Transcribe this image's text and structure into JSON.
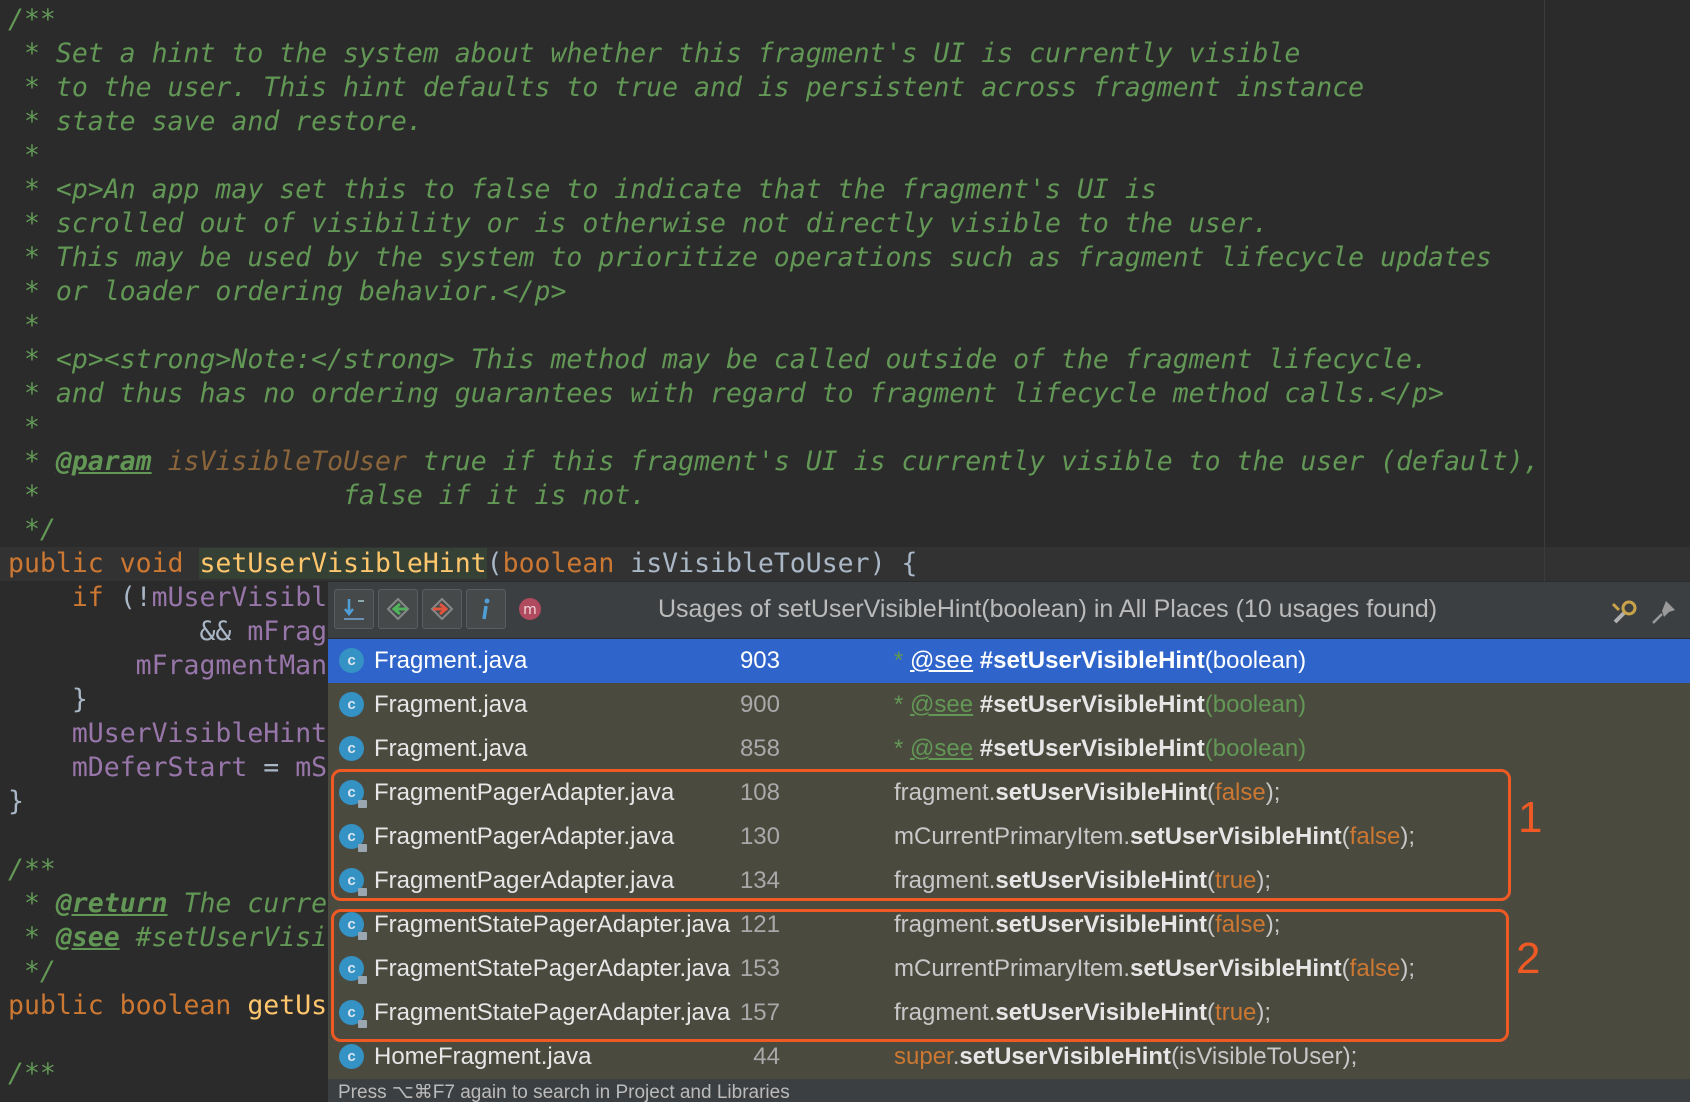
{
  "editor": {
    "lines": [
      {
        "segs": [
          {
            "t": "/**",
            "c": "doc"
          }
        ]
      },
      {
        "segs": [
          {
            "t": " * Set a hint to the system about whether this fragment's UI is currently visible",
            "c": "doc"
          }
        ]
      },
      {
        "segs": [
          {
            "t": " * to the user. This hint defaults to true and is persistent across fragment instance",
            "c": "doc"
          }
        ]
      },
      {
        "segs": [
          {
            "t": " * state save and restore.",
            "c": "doc"
          }
        ]
      },
      {
        "segs": [
          {
            "t": " *",
            "c": "doc"
          }
        ]
      },
      {
        "segs": [
          {
            "t": " * ",
            "c": "doc"
          },
          {
            "t": "<p>",
            "c": "tag"
          },
          {
            "t": "An app may set this to false to indicate that the fragment's UI is",
            "c": "doc"
          }
        ]
      },
      {
        "segs": [
          {
            "t": " * scrolled out of visibility or is otherwise not directly visible to the user.",
            "c": "doc"
          }
        ]
      },
      {
        "segs": [
          {
            "t": " * This may be used by the system to prioritize operations such as fragment lifecycle updates",
            "c": "doc"
          }
        ]
      },
      {
        "segs": [
          {
            "t": " * or loader ordering behavior.",
            "c": "doc"
          },
          {
            "t": "</p>",
            "c": "tag"
          }
        ]
      },
      {
        "segs": [
          {
            "t": " *",
            "c": "doc"
          }
        ]
      },
      {
        "segs": [
          {
            "t": " * ",
            "c": "doc"
          },
          {
            "t": "<p><strong>",
            "c": "tag"
          },
          {
            "t": "Note:",
            "c": "doc"
          },
          {
            "t": "</strong>",
            "c": "tag"
          },
          {
            "t": " This method may be called outside of the fragment lifecycle.",
            "c": "doc"
          }
        ]
      },
      {
        "segs": [
          {
            "t": " * and thus has no ordering guarantees with regard to fragment lifecycle method calls.",
            "c": "doc"
          },
          {
            "t": "</p>",
            "c": "tag"
          }
        ]
      },
      {
        "segs": [
          {
            "t": " *",
            "c": "doc"
          }
        ]
      },
      {
        "segs": [
          {
            "t": " * ",
            "c": "doc"
          },
          {
            "t": "@param",
            "c": "dtag"
          },
          {
            "t": " ",
            "c": "doc"
          },
          {
            "t": "isVisibleToUser",
            "c": "dparam"
          },
          {
            "t": " true if this fragment's UI is currently visible to the user (default),",
            "c": "doc"
          }
        ]
      },
      {
        "segs": [
          {
            "t": " *                   false if it is not.",
            "c": "doc"
          }
        ]
      },
      {
        "segs": [
          {
            "t": " */",
            "c": "doc"
          }
        ]
      },
      {
        "segs": [
          {
            "t": "public void ",
            "c": "kw"
          },
          {
            "t": "setUserVisibleHint",
            "c": "fn decl-hl"
          },
          {
            "t": "(",
            "c": ""
          },
          {
            "t": "boolean ",
            "c": "kw"
          },
          {
            "t": "isVisibleToUser) {",
            "c": ""
          }
        ]
      },
      {
        "segs": [
          {
            "t": "    ",
            "c": ""
          },
          {
            "t": "if ",
            "c": "kw"
          },
          {
            "t": "(!",
            "c": ""
          },
          {
            "t": "mUserVisibl",
            "c": "fld"
          }
        ]
      },
      {
        "segs": [
          {
            "t": "            && ",
            "c": ""
          },
          {
            "t": "mFrag",
            "c": "fld"
          }
        ]
      },
      {
        "segs": [
          {
            "t": "        ",
            "c": ""
          },
          {
            "t": "mFragmentMan",
            "c": "fld"
          }
        ]
      },
      {
        "segs": [
          {
            "t": "    }",
            "c": ""
          }
        ]
      },
      {
        "segs": [
          {
            "t": "    ",
            "c": ""
          },
          {
            "t": "mUserVisibleHint",
            "c": "fld"
          }
        ]
      },
      {
        "segs": [
          {
            "t": "    ",
            "c": ""
          },
          {
            "t": "mDeferStart",
            "c": "fld"
          },
          {
            "t": " = ",
            "c": ""
          },
          {
            "t": "mS",
            "c": "fld"
          }
        ]
      },
      {
        "segs": [
          {
            "t": "}",
            "c": ""
          }
        ]
      },
      {
        "segs": [
          {
            "t": "",
            "c": ""
          }
        ]
      },
      {
        "segs": [
          {
            "t": "/**",
            "c": "doc"
          }
        ]
      },
      {
        "segs": [
          {
            "t": " * ",
            "c": "doc"
          },
          {
            "t": "@return",
            "c": "dtag"
          },
          {
            "t": " The curre",
            "c": "doc"
          }
        ]
      },
      {
        "segs": [
          {
            "t": " * ",
            "c": "doc"
          },
          {
            "t": "@see",
            "c": "dtag"
          },
          {
            "t": " #setUserVisi",
            "c": "doc"
          }
        ]
      },
      {
        "segs": [
          {
            "t": " */",
            "c": "doc"
          }
        ]
      },
      {
        "segs": [
          {
            "t": "public boolean ",
            "c": "kw"
          },
          {
            "t": "getUs",
            "c": "fn"
          }
        ]
      },
      {
        "segs": [
          {
            "t": "",
            "c": ""
          }
        ]
      },
      {
        "segs": [
          {
            "t": "/**",
            "c": "doc"
          }
        ]
      }
    ]
  },
  "popup": {
    "title": "Usages of setUserVisibleHint(boolean) in All Places (10 usages found)",
    "icons": [
      "expand-icon",
      "previous-occurrence-icon",
      "next-occurrence-icon",
      "info-icon",
      "method-icon"
    ],
    "rows": [
      {
        "file": "Fragment.java",
        "line": "903",
        "locked": false,
        "selected": true,
        "code": [
          {
            "t": "* ",
            "c": "dc"
          },
          {
            "t": "@see",
            "c": "dcu"
          },
          {
            "t": " ",
            "c": "dc"
          },
          {
            "t": "#setUserVisibleHint",
            "c": "m"
          },
          {
            "t": "(boolean)",
            "c": ""
          }
        ]
      },
      {
        "file": "Fragment.java",
        "line": "900",
        "locked": false,
        "selected": false,
        "code": [
          {
            "t": "* ",
            "c": "dc"
          },
          {
            "t": "@see",
            "c": "dcu"
          },
          {
            "t": " ",
            "c": "dc"
          },
          {
            "t": "#setUserVisibleHint",
            "c": "m"
          },
          {
            "t": "(boolean)",
            "c": "dc"
          }
        ]
      },
      {
        "file": "Fragment.java",
        "line": "858",
        "locked": false,
        "selected": false,
        "code": [
          {
            "t": "* ",
            "c": "dc"
          },
          {
            "t": "@see",
            "c": "dcu"
          },
          {
            "t": " ",
            "c": "dc"
          },
          {
            "t": "#setUserVisibleHint",
            "c": "m"
          },
          {
            "t": "(boolean)",
            "c": "dc"
          }
        ]
      },
      {
        "file": "FragmentPagerAdapter.java",
        "line": "108",
        "locked": true,
        "selected": false,
        "code": [
          {
            "t": "fragment.",
            "c": ""
          },
          {
            "t": "setUserVisibleHint",
            "c": "m"
          },
          {
            "t": "(",
            "c": ""
          },
          {
            "t": "false",
            "c": "k"
          },
          {
            "t": ");",
            "c": ""
          }
        ]
      },
      {
        "file": "FragmentPagerAdapter.java",
        "line": "130",
        "locked": true,
        "selected": false,
        "code": [
          {
            "t": "mCurrentPrimaryItem.",
            "c": ""
          },
          {
            "t": "setUserVisibleHint",
            "c": "m"
          },
          {
            "t": "(",
            "c": ""
          },
          {
            "t": "false",
            "c": "k"
          },
          {
            "t": ");",
            "c": ""
          }
        ]
      },
      {
        "file": "FragmentPagerAdapter.java",
        "line": "134",
        "locked": true,
        "selected": false,
        "code": [
          {
            "t": "fragment.",
            "c": ""
          },
          {
            "t": "setUserVisibleHint",
            "c": "m"
          },
          {
            "t": "(",
            "c": ""
          },
          {
            "t": "true",
            "c": "k"
          },
          {
            "t": ");",
            "c": ""
          }
        ]
      },
      {
        "file": "FragmentStatePagerAdapter.java",
        "line": "121",
        "locked": true,
        "selected": false,
        "code": [
          {
            "t": "fragment.",
            "c": ""
          },
          {
            "t": "setUserVisibleHint",
            "c": "m"
          },
          {
            "t": "(",
            "c": ""
          },
          {
            "t": "false",
            "c": "k"
          },
          {
            "t": ");",
            "c": ""
          }
        ]
      },
      {
        "file": "FragmentStatePagerAdapter.java",
        "line": "153",
        "locked": true,
        "selected": false,
        "code": [
          {
            "t": "mCurrentPrimaryItem.",
            "c": ""
          },
          {
            "t": "setUserVisibleHint",
            "c": "m"
          },
          {
            "t": "(",
            "c": ""
          },
          {
            "t": "false",
            "c": "k"
          },
          {
            "t": ");",
            "c": ""
          }
        ]
      },
      {
        "file": "FragmentStatePagerAdapter.java",
        "line": "157",
        "locked": true,
        "selected": false,
        "code": [
          {
            "t": "fragment.",
            "c": ""
          },
          {
            "t": "setUserVisibleHint",
            "c": "m"
          },
          {
            "t": "(",
            "c": ""
          },
          {
            "t": "true",
            "c": "k"
          },
          {
            "t": ");",
            "c": ""
          }
        ]
      },
      {
        "file": "HomeFragment.java",
        "line": "44",
        "locked": false,
        "selected": false,
        "code": [
          {
            "t": "super",
            "c": "k"
          },
          {
            "t": ".",
            "c": ""
          },
          {
            "t": "setUserVisibleHint",
            "c": "m"
          },
          {
            "t": "(isVisibleToUser);",
            "c": ""
          }
        ]
      }
    ],
    "footer": "Press ⌥⌘F7 again to search in Project and Libraries"
  },
  "annotations": [
    {
      "label": "1"
    },
    {
      "label": "2"
    }
  ],
  "colors": {
    "accent_box": "#ef5a24",
    "selection": "#2f65ca",
    "comment": "#629755",
    "keyword": "#cc7832",
    "method": "#ffc66d",
    "field": "#9876aa"
  }
}
